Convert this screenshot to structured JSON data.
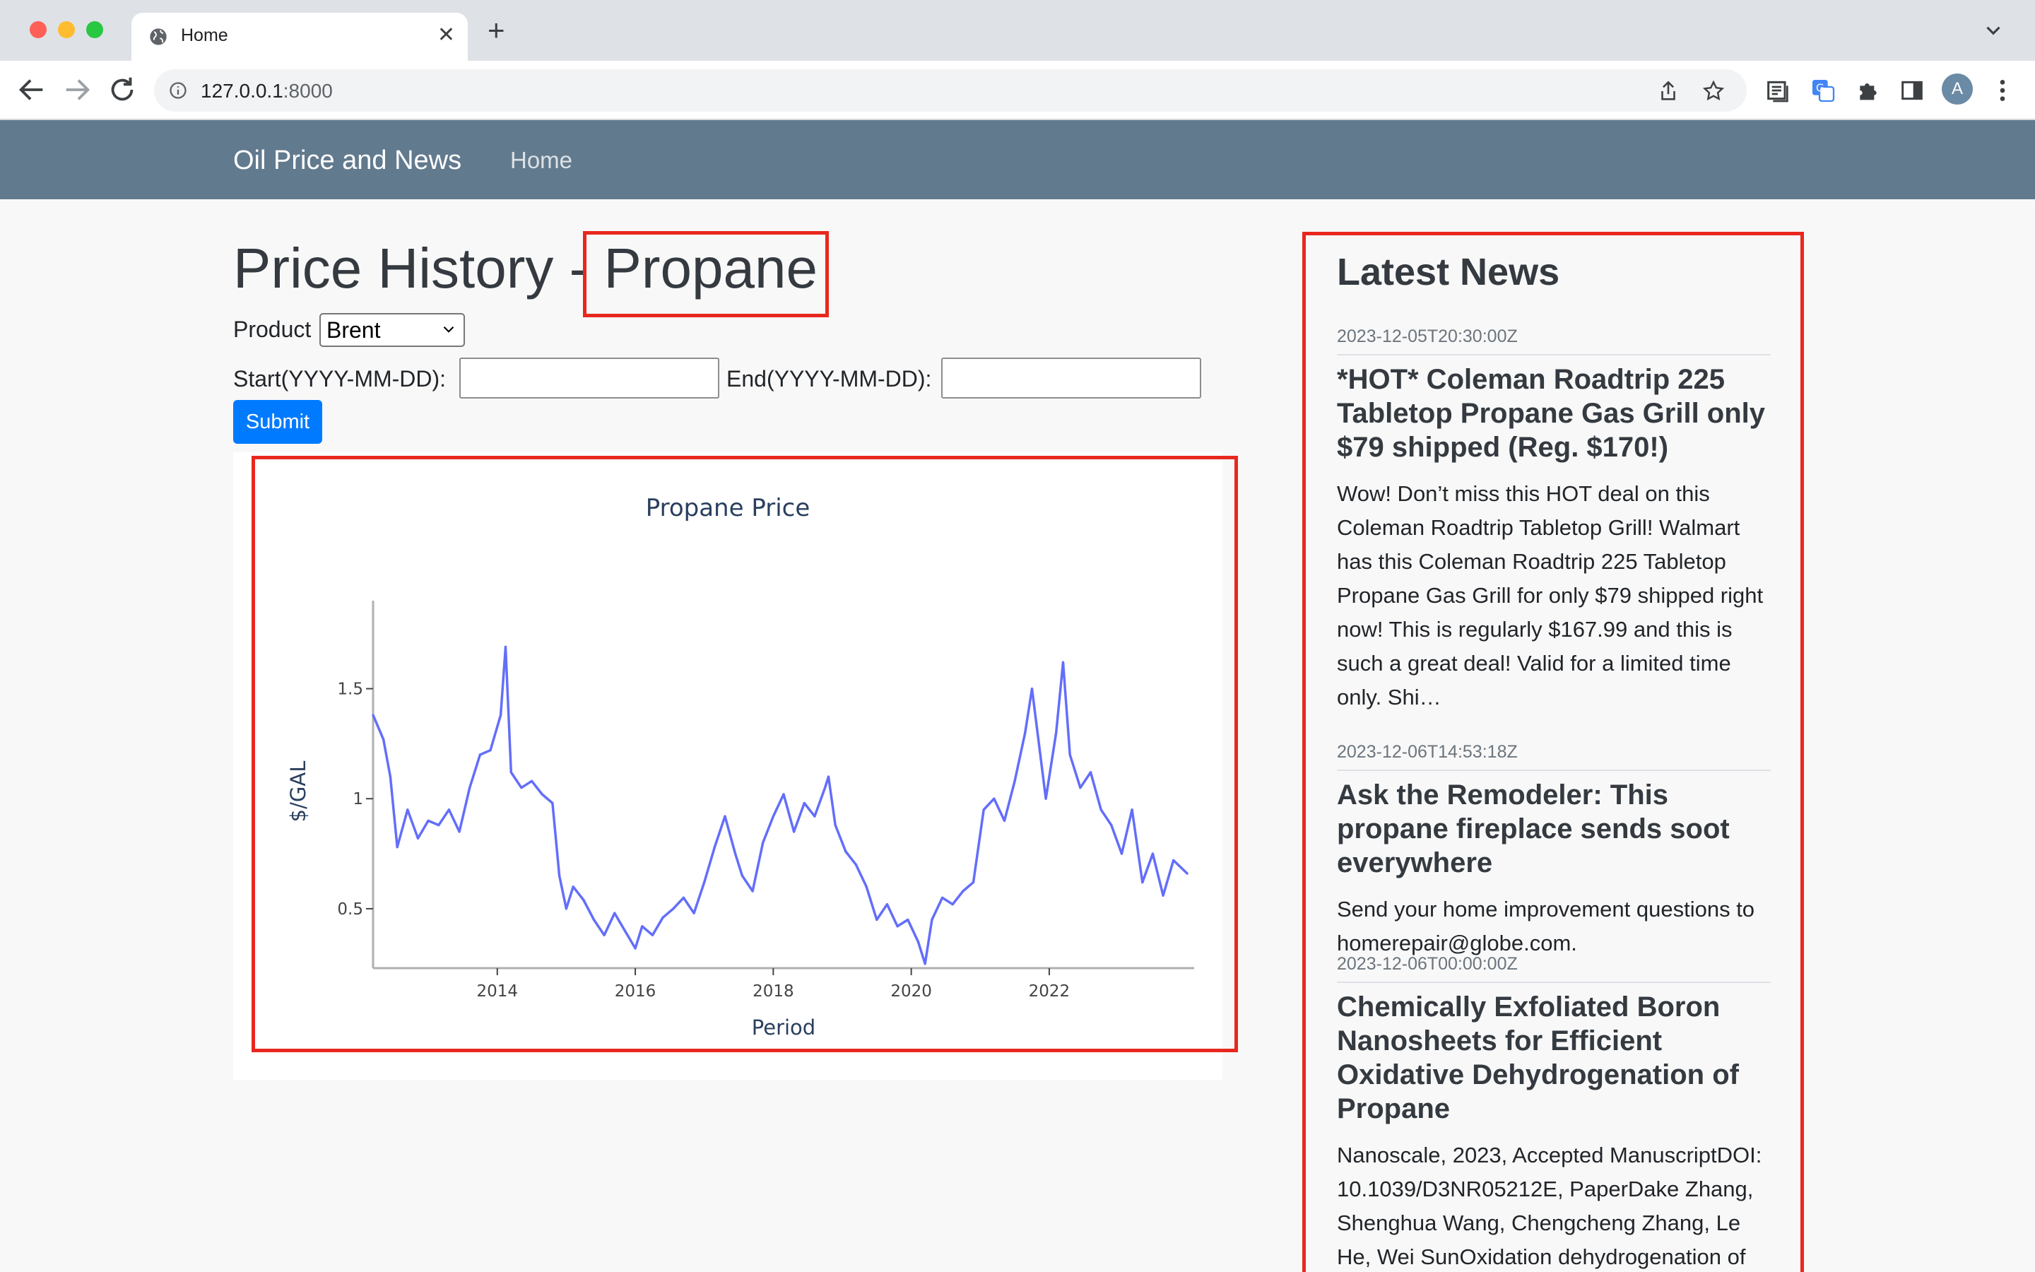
{
  "browser": {
    "tab_title": "Home",
    "url_host": "127.0.0.1",
    "url_port": ":8000",
    "profile_initial": "A"
  },
  "navbar": {
    "brand": "Oil Price and News",
    "home_link": "Home"
  },
  "page": {
    "title_prefix": "Price History - ",
    "title_product": "Propane",
    "product_label": "Product",
    "product_selected": "Brent",
    "start_label": "Start(YYYY-MM-DD):",
    "end_label": "End(YYYY-MM-DD):",
    "start_value": "",
    "end_value": "",
    "submit_label": "Submit"
  },
  "chart_data": {
    "type": "line",
    "title": "Propane Price",
    "xlabel": "Period",
    "ylabel": "$/GAL",
    "xticks": [
      "2014",
      "2016",
      "2018",
      "2020",
      "2022"
    ],
    "yticks": [
      "0.5",
      "1",
      "1.5"
    ],
    "xlim": [
      2012.2,
      2024.1
    ],
    "ylim": [
      0.23,
      1.9
    ],
    "line_color": "#636efa",
    "grid": false,
    "x": [
      2012.2,
      2012.35,
      2012.45,
      2012.55,
      2012.7,
      2012.85,
      2013.0,
      2013.15,
      2013.3,
      2013.45,
      2013.6,
      2013.75,
      2013.9,
      2014.05,
      2014.12,
      2014.2,
      2014.35,
      2014.5,
      2014.65,
      2014.8,
      2014.9,
      2015.0,
      2015.1,
      2015.25,
      2015.4,
      2015.55,
      2015.7,
      2015.85,
      2016.0,
      2016.1,
      2016.25,
      2016.4,
      2016.55,
      2016.7,
      2016.85,
      2017.0,
      2017.15,
      2017.3,
      2017.45,
      2017.55,
      2017.7,
      2017.85,
      2018.0,
      2018.15,
      2018.3,
      2018.45,
      2018.6,
      2018.75,
      2018.8,
      2018.9,
      2019.05,
      2019.2,
      2019.35,
      2019.5,
      2019.65,
      2019.8,
      2019.95,
      2020.1,
      2020.2,
      2020.3,
      2020.45,
      2020.6,
      2020.75,
      2020.9,
      2021.05,
      2021.2,
      2021.35,
      2021.5,
      2021.65,
      2021.75,
      2021.85,
      2021.95,
      2022.1,
      2022.2,
      2022.3,
      2022.45,
      2022.6,
      2022.75,
      2022.9,
      2023.05,
      2023.2,
      2023.35,
      2023.5,
      2023.65,
      2023.8,
      2024.0
    ],
    "y": [
      1.38,
      1.27,
      1.1,
      0.78,
      0.95,
      0.82,
      0.9,
      0.88,
      0.95,
      0.85,
      1.05,
      1.2,
      1.22,
      1.38,
      1.69,
      1.12,
      1.05,
      1.08,
      1.02,
      0.98,
      0.65,
      0.5,
      0.6,
      0.54,
      0.45,
      0.38,
      0.48,
      0.4,
      0.32,
      0.42,
      0.38,
      0.46,
      0.5,
      0.55,
      0.48,
      0.62,
      0.78,
      0.92,
      0.75,
      0.65,
      0.58,
      0.8,
      0.92,
      1.02,
      0.85,
      0.98,
      0.92,
      1.05,
      1.1,
      0.88,
      0.76,
      0.7,
      0.6,
      0.45,
      0.52,
      0.42,
      0.45,
      0.35,
      0.25,
      0.45,
      0.55,
      0.52,
      0.58,
      0.62,
      0.95,
      1.0,
      0.9,
      1.08,
      1.3,
      1.5,
      1.25,
      1.0,
      1.3,
      1.62,
      1.2,
      1.05,
      1.12,
      0.95,
      0.88,
      0.75,
      0.95,
      0.62,
      0.75,
      0.56,
      0.72,
      0.66
    ]
  },
  "news": {
    "heading": "Latest News",
    "items": [
      {
        "date": "2023-12-05T20:30:00Z",
        "title": "*HOT* Coleman Roadtrip 225 Tabletop Propane Gas Grill only $79 shipped (Reg. $170!)",
        "body": "Wow! Don’t miss this HOT deal on this Coleman Roadtrip Tabletop Grill! Walmart has this Coleman Roadtrip 225 Tabletop Propane Gas Grill for only $79 shipped right now! This is regularly $167.99 and this is such a great deal! Valid for a limited time only. Shi…"
      },
      {
        "date": "2023-12-06T14:53:18Z",
        "title": "Ask the Remodeler: This propane fireplace sends soot everywhere",
        "body": "Send your home improvement questions to homerepair@globe.com."
      },
      {
        "date": "2023-12-06T00:00:00Z",
        "title": "Chemically Exfoliated Boron Nanosheets for Efficient Oxidative Dehydrogenation of Propane",
        "body": "Nanoscale, 2023, Accepted ManuscriptDOI: 10.1039/D3NR05212E, PaperDake Zhang, Shenghua Wang, Chengcheng Zhang, Le He, Wei SunOxidation dehydrogenation of propane"
      }
    ]
  },
  "colors": {
    "navbar": "#627a8e",
    "submit": "#007bff",
    "highlight": "#e8281e",
    "line": "#636efa"
  }
}
